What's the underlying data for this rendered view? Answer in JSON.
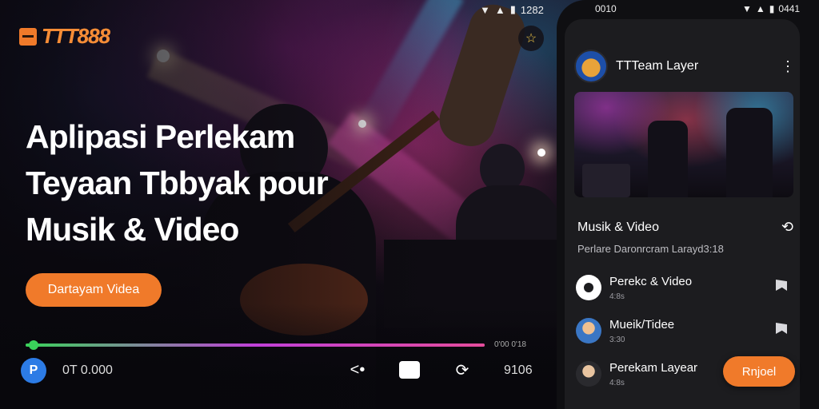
{
  "brand": {
    "logo_text": "TTT888"
  },
  "status_bar": {
    "left_time": "1282",
    "phone_time": "0010",
    "phone_right": "0441"
  },
  "hero": {
    "line1": "Aplipasi Perlekam",
    "line2": "Teyaan Tbbyak pour",
    "line3": "Musik & Video",
    "cta_label": "Dartayam Videa"
  },
  "player": {
    "counter": "0T 0.000",
    "elapsed": "9106",
    "time_right": "0'00 0'18",
    "progress": 1.0,
    "icons": [
      "play-badge-icon",
      "share-icon",
      "stop-icon",
      "sync-icon"
    ]
  },
  "phone": {
    "header_title": "TTTeam Layer",
    "section_title": "Musik & Video",
    "section_sub": "Perlare Daronrcram Larayd3:18",
    "items": [
      {
        "title": "Perekc & Video",
        "meta": "4:8s"
      },
      {
        "title": "Mueik/Tidee",
        "meta": "3:30"
      },
      {
        "title": "Perekam Layear",
        "meta": "4:8s"
      }
    ],
    "fab_label": "Rnjoel"
  },
  "colors": {
    "accent": "#f07a2a",
    "progress_start": "#3ad35a",
    "progress_end": "#e54c9c",
    "badge_blue": "#2c7be5"
  }
}
